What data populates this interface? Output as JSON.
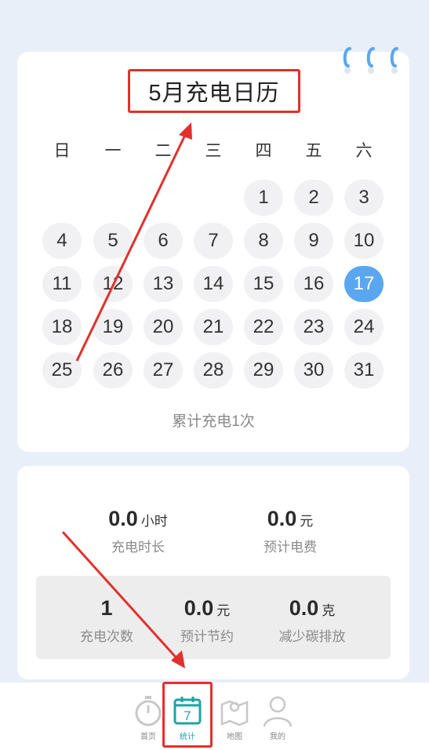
{
  "calendar": {
    "title": "5月充电日历",
    "weekdays": [
      "日",
      "一",
      "二",
      "三",
      "四",
      "五",
      "六"
    ],
    "days": [
      "1",
      "2",
      "3",
      "4",
      "5",
      "6",
      "7",
      "8",
      "9",
      "10",
      "11",
      "12",
      "13",
      "14",
      "15",
      "16",
      "17",
      "18",
      "19",
      "20",
      "21",
      "22",
      "23",
      "24",
      "25",
      "26",
      "27",
      "28",
      "29",
      "30",
      "31"
    ],
    "today": "17",
    "summary": "累计充电1次"
  },
  "stats": {
    "duration": {
      "value": "0.0",
      "unit": "小时",
      "label": "充电时长"
    },
    "fee": {
      "value": "0.0",
      "unit": "元",
      "label": "预计电费"
    },
    "count": {
      "value": "1",
      "unit": "",
      "label": "充电次数"
    },
    "savings": {
      "value": "0.0",
      "unit": "元",
      "label": "预计节约"
    },
    "carbon": {
      "value": "0.0",
      "unit": "克",
      "label": "减少碳排放"
    }
  },
  "tabs": [
    {
      "label": "首页",
      "icon": "stopwatch-icon"
    },
    {
      "label": "统计",
      "icon": "calendar-7-icon"
    },
    {
      "label": "地图",
      "icon": "map-icon"
    },
    {
      "label": "我的",
      "icon": "person-icon"
    }
  ],
  "colors": {
    "accent": "#5ba6f0",
    "active_tab": "#1fa3a3",
    "annotation": "#e3302c",
    "background": "#e8eff9"
  }
}
